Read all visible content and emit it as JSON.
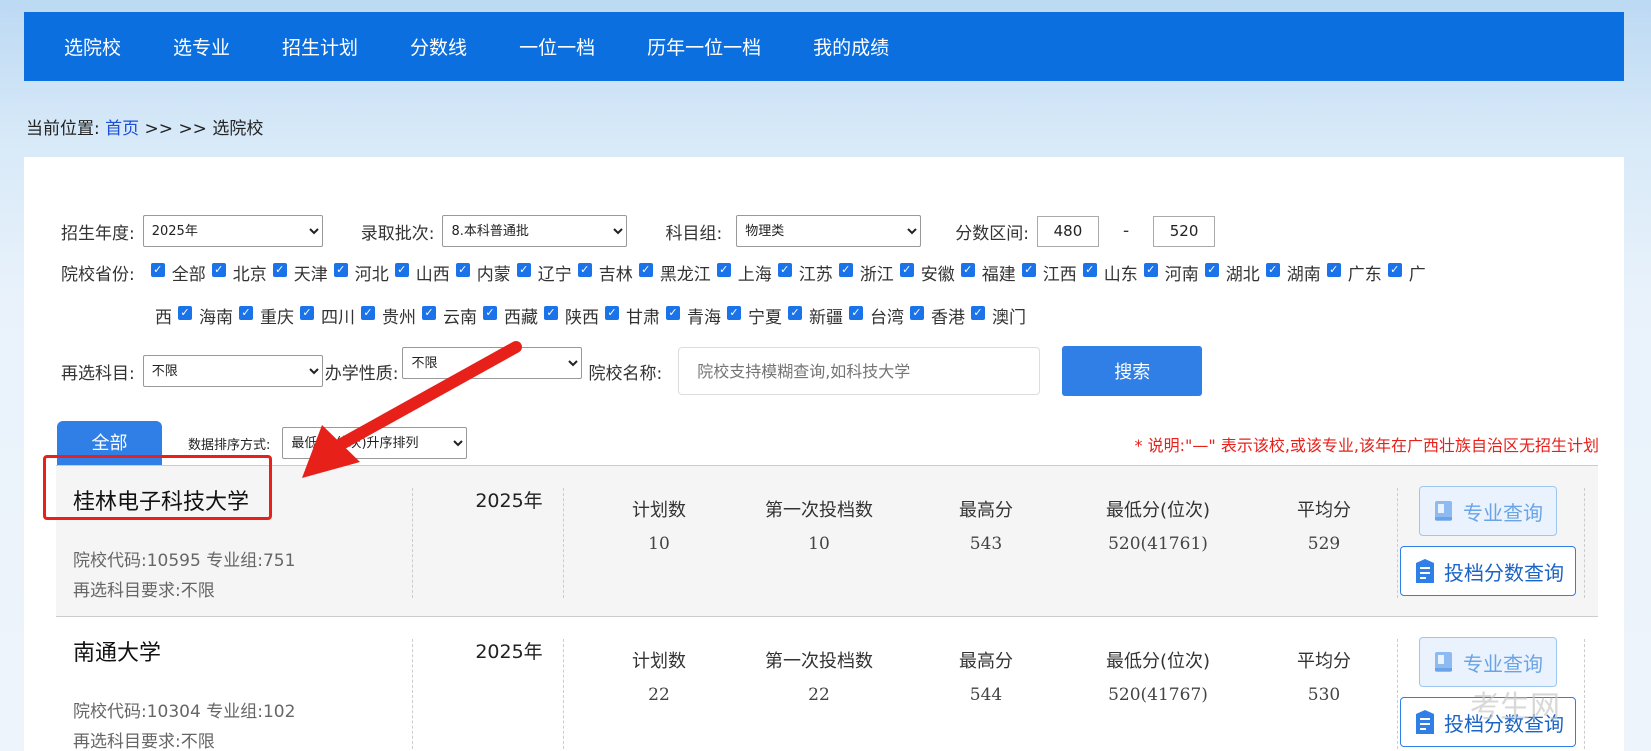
{
  "nav": {
    "items": [
      "选院校",
      "选专业",
      "招生计划",
      "分数线",
      "一位一档",
      "历年一位一档",
      "我的成绩"
    ]
  },
  "breadcrumb": {
    "prefix": "当前位置:",
    "home": "首页",
    "rest": ">> >> 选院校"
  },
  "filters": {
    "year_label": "招生年度:",
    "year_value": "2025年",
    "batch_label": "录取批次:",
    "batch_value": "8.本科普通批",
    "subject_label": "科目组:",
    "subject_value": "物理类",
    "score_label": "分数区间:",
    "score_min": "480",
    "score_sep": "-",
    "score_max": "520",
    "province_label": "院校省份:",
    "provinces_row1": [
      "全部",
      "北京",
      "天津",
      "河北",
      "山西",
      "内蒙",
      "辽宁",
      "吉林",
      "黑龙江",
      "上海",
      "江苏",
      "浙江",
      "安徽",
      "福建",
      "江西",
      "山东",
      "河南",
      "湖北",
      "湖南",
      "广东",
      "广"
    ],
    "provinces_row2_first": "西",
    "provinces_row2": [
      "海南",
      "重庆",
      "四川",
      "贵州",
      "云南",
      "西藏",
      "陕西",
      "甘肃",
      "青海",
      "宁夏",
      "新疆",
      "台湾",
      "香港",
      "澳门"
    ],
    "reselect_label": "再选科目:",
    "reselect_value": "不限",
    "nature_label": "办学性质:",
    "nature_value": "不限",
    "name_label": "院校名称:",
    "name_placeholder": "院校支持模糊查询,如科技大学",
    "search_button": "搜索"
  },
  "tab_all": "全部",
  "sort": {
    "label": "数据排序方式:",
    "value": "最低分(位次)升序排列"
  },
  "note": "* 说明:\"—\" 表示该校,或该专业,该年在广西壮族自治区无招生计划",
  "results": [
    {
      "name": "桂林电子科技大学",
      "code_line": "院校代码:10595    专业组:751",
      "req_line": "再选科目要求:不限",
      "year": "2025年",
      "stats": [
        {
          "h": "计划数",
          "v": "10"
        },
        {
          "h": "第一次投档数",
          "v": "10"
        },
        {
          "h": "最高分",
          "v": "543"
        },
        {
          "h": "最低分(位次)",
          "v": "520(41761)"
        },
        {
          "h": "平均分",
          "v": "529"
        }
      ],
      "btn_major": "专业查询",
      "btn_score": "投档分数查询"
    },
    {
      "name": "南通大学",
      "code_line": "院校代码:10304    专业组:102",
      "req_line": "再选科目要求:不限",
      "year": "2025年",
      "stats": [
        {
          "h": "计划数",
          "v": "22"
        },
        {
          "h": "第一次投档数",
          "v": "22"
        },
        {
          "h": "最高分",
          "v": "544"
        },
        {
          "h": "最低分(位次)",
          "v": "520(41767)"
        },
        {
          "h": "平均分",
          "v": "530"
        }
      ],
      "btn_major": "专业查询",
      "btn_score": "投档分数查询"
    }
  ],
  "watermark": "考生网",
  "colors": {
    "nav": "#0b6fe0",
    "button": "#2f7fe6",
    "note": "#e8201a",
    "highlight": "#e8201a"
  }
}
